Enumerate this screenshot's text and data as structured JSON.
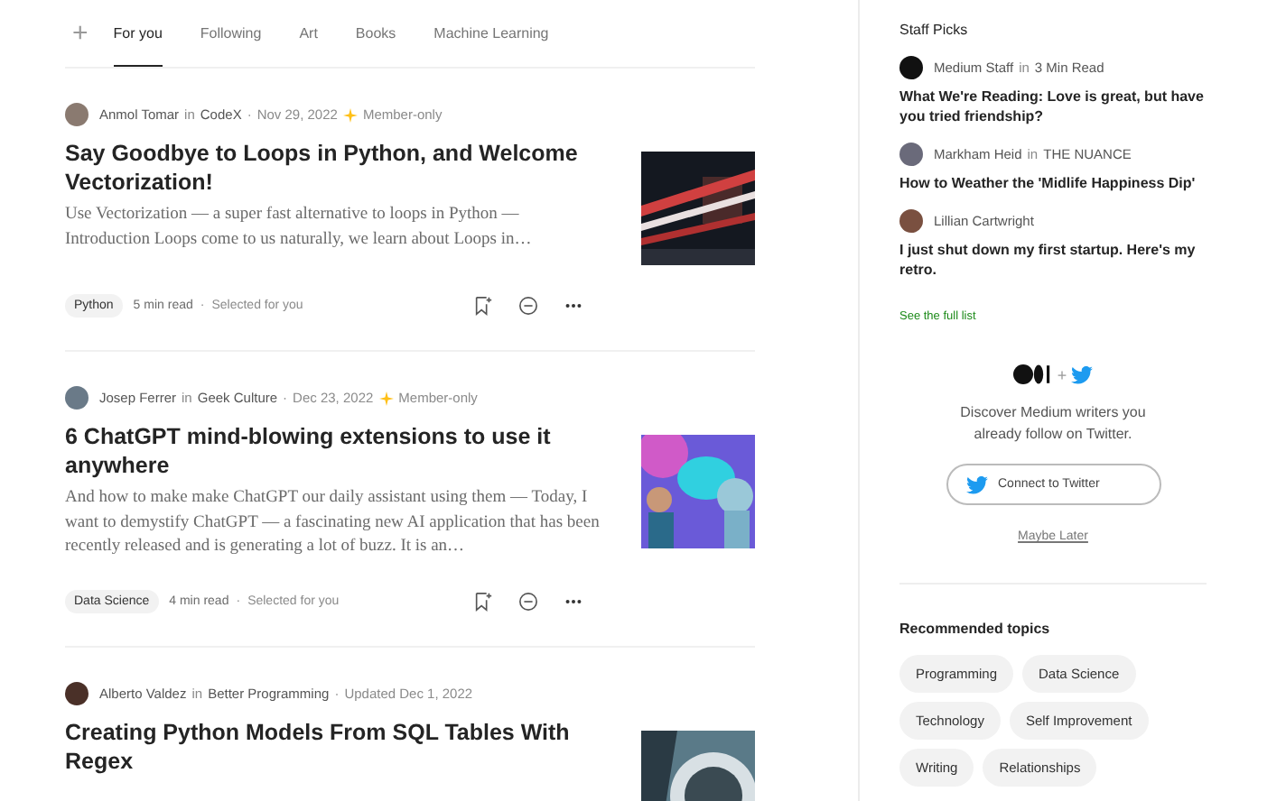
{
  "tabs": [
    {
      "label": "For you",
      "selected": true
    },
    {
      "label": "Following",
      "selected": false
    },
    {
      "label": "Art",
      "selected": false
    },
    {
      "label": "Books",
      "selected": false
    },
    {
      "label": "Machine Learning",
      "selected": false
    }
  ],
  "add": "+",
  "articles": [
    {
      "author": "Anmol Tomar",
      "in": "in",
      "publication": "CodeX",
      "separator": "·",
      "date": "Nov 29, 2022",
      "member_only": true,
      "member_label": "Member-only",
      "title": "Say Goodbye to Loops in Python, and Welcome Vectorization!",
      "excerpt": "Use Vectorization — a super fast alternative to loops in Python — Introduction Loops come to us naturally, we learn about Loops in…",
      "tag": "Python",
      "read_time": "5 min read",
      "dot": "·",
      "reason": "Selected for you"
    },
    {
      "author": "Josep Ferrer",
      "in": "in",
      "publication": "Geek Culture",
      "separator": "·",
      "date": "Dec 23, 2022",
      "member_only": true,
      "member_label": "Member-only",
      "title": "6 ChatGPT mind-blowing extensions to use it anywhere",
      "excerpt": "And how to make make ChatGPT our daily assistant using them — Today, I want to demystify ChatGPT — a fascinating new AI application that has been recently released and is generating a lot of buzz. It is an…",
      "tag": "Data Science",
      "read_time": "4 min read",
      "dot": "·",
      "reason": "Selected for you"
    },
    {
      "author": "Alberto Valdez",
      "in": "in",
      "publication": "Better Programming",
      "separator": "·",
      "date": "Updated Dec 1, 2022",
      "title": "Creating Python Models From SQL Tables With Regex"
    }
  ],
  "staff_picks": {
    "title": "Staff Picks",
    "items": [
      {
        "author": "Medium Staff",
        "in": "in",
        "publication": "3 Min Read",
        "title": "What We're Reading: Love is great, but have you tried friendship?"
      },
      {
        "author": "Markham Heid",
        "in": "in",
        "publication": "THE NUANCE",
        "title": "How to Weather the 'Midlife Happiness Dip'"
      },
      {
        "author": "Lillian Cartwright",
        "title": "I just shut down my first startup. Here's my retro."
      }
    ],
    "link": "See the full list"
  },
  "twitter": {
    "plus": "+",
    "text": "Discover Medium writers you already follow on Twitter.",
    "button": "Connect to Twitter",
    "later": "Maybe Later"
  },
  "topics": {
    "title": "Recommended topics",
    "items": [
      "Programming",
      "Data Science",
      "Technology",
      "Self Improvement",
      "Writing",
      "Relationships"
    ]
  }
}
